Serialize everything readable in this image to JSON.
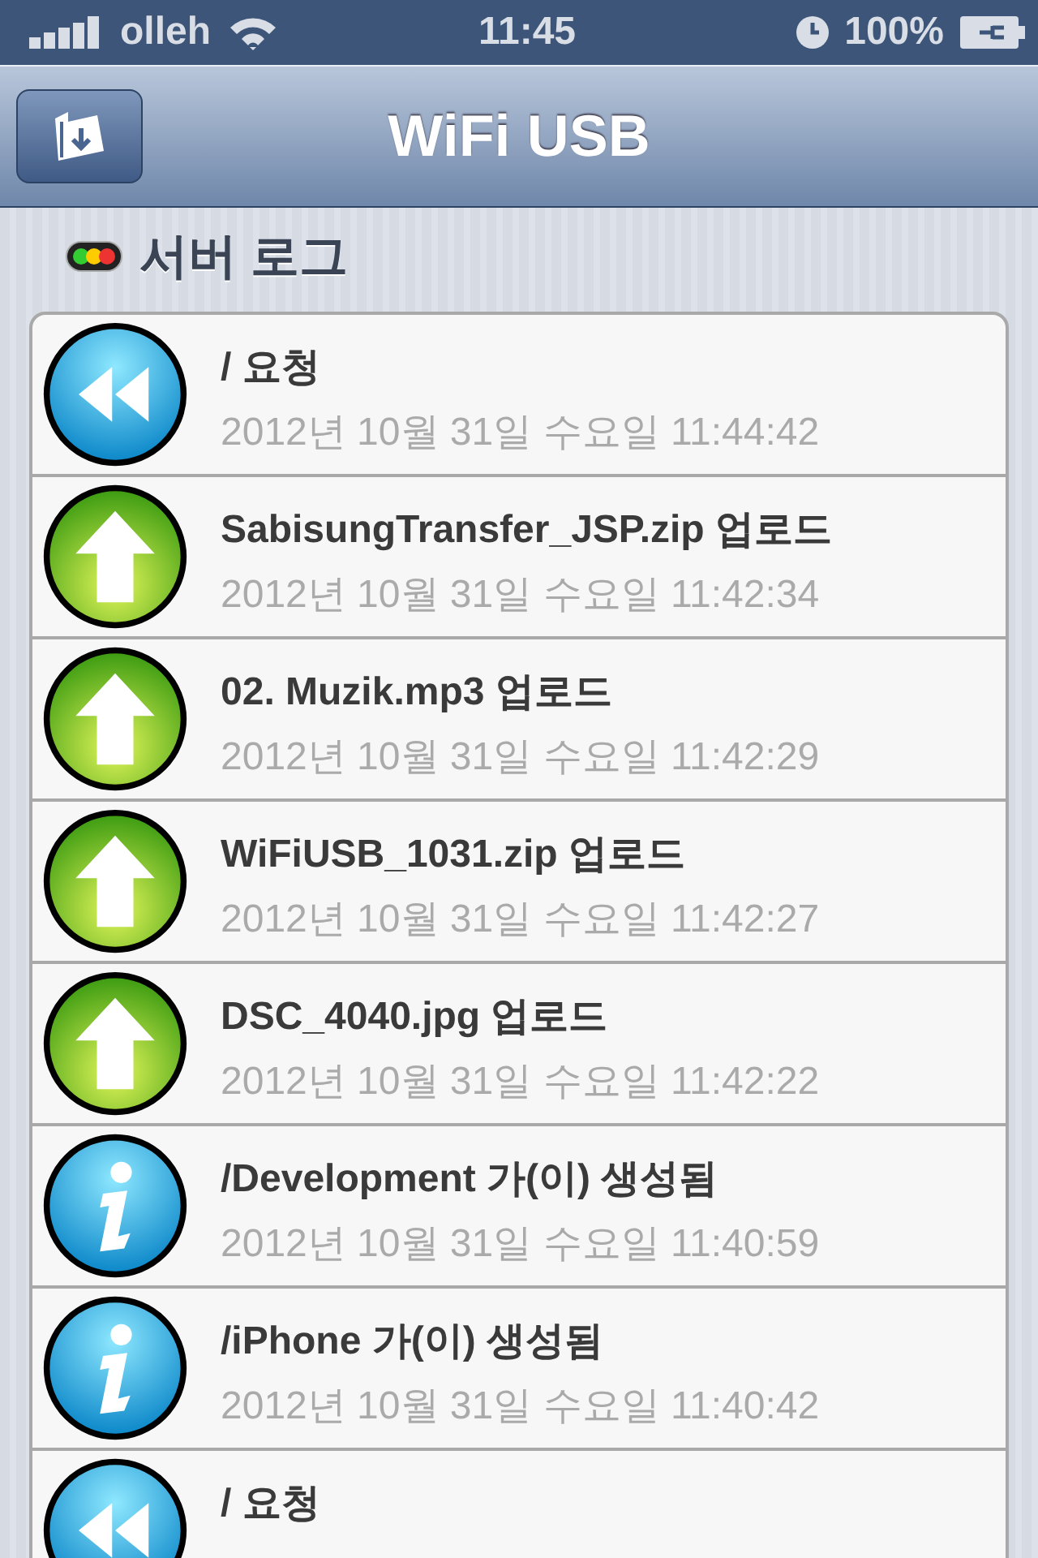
{
  "status_bar": {
    "carrier": "olleh",
    "time": "11:45",
    "battery": "100%"
  },
  "nav_bar": {
    "title": "WiFi USB"
  },
  "section": {
    "title": "서버 로그"
  },
  "log": [
    {
      "kind": "request",
      "title": "/ 요청",
      "time": "2012년 10월 31일 수요일 11:44:42"
    },
    {
      "kind": "upload",
      "title": "SabisungTransfer_JSP.zip 업로드",
      "time": "2012년 10월 31일 수요일 11:42:34"
    },
    {
      "kind": "upload",
      "title": "02. Muzik.mp3 업로드",
      "time": "2012년 10월 31일 수요일 11:42:29"
    },
    {
      "kind": "upload",
      "title": "WiFiUSB_1031.zip 업로드",
      "time": "2012년 10월 31일 수요일 11:42:27"
    },
    {
      "kind": "upload",
      "title": "DSC_4040.jpg 업로드",
      "time": "2012년 10월 31일 수요일 11:42:22"
    },
    {
      "kind": "info",
      "title": "/Development 가(이) 생성됨",
      "time": "2012년 10월 31일 수요일 11:40:59"
    },
    {
      "kind": "info",
      "title": "/iPhone 가(이) 생성됨",
      "time": "2012년 10월 31일 수요일 11:40:42"
    },
    {
      "kind": "request",
      "title": "/ 요청"
    }
  ]
}
